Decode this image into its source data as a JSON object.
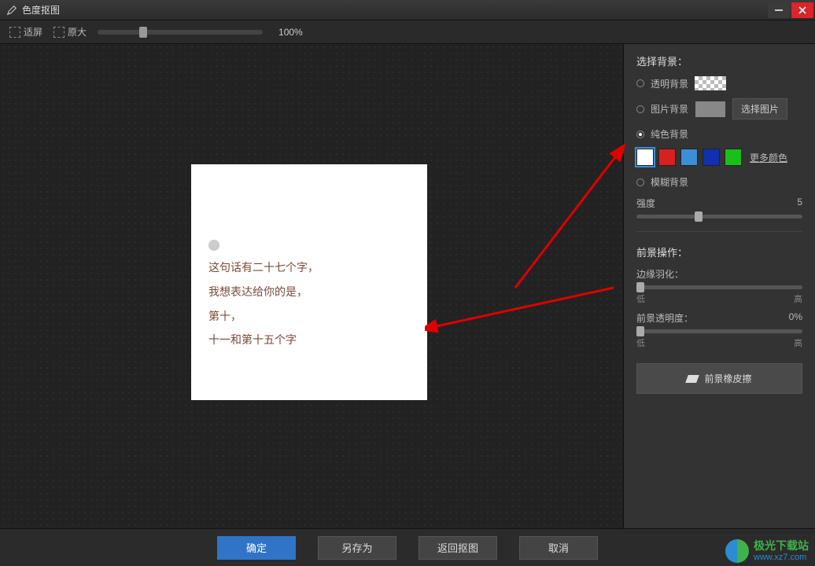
{
  "window": {
    "title": "色度抠图"
  },
  "toolbar": {
    "fit_label": "适屏",
    "orig_label": "原大",
    "zoom_percent": "100%"
  },
  "canvas": {
    "lines": [
      "这句话有二十七个字，",
      "我想表达给你的是，",
      "第十，",
      "十一和第十五个字"
    ]
  },
  "sidebar": {
    "bg_section": "选择背景：",
    "transparent": "透明背景",
    "image_bg": "图片背景",
    "choose_image_btn": "选择图片",
    "solid_bg": "纯色背景",
    "more_colors": "更多颜色",
    "blur_bg": "模糊背景",
    "intensity_label": "强度",
    "intensity_value": "5",
    "fg_section": "前景操作：",
    "feather_label": "边缘羽化：",
    "low": "低",
    "high": "高",
    "opacity_label": "前景透明度：",
    "opacity_value": "0%",
    "eraser_btn": "前景橡皮擦"
  },
  "colors": {
    "swatches": [
      "#ffffff",
      "#d92020",
      "#3a8fd8",
      "#1030b0",
      "#18c018"
    ]
  },
  "footer": {
    "ok": "确定",
    "save_as": "另存为",
    "back": "返回抠图",
    "cancel": "取消"
  },
  "watermark": {
    "name": "极光下载站",
    "url": "www.xz7.com"
  }
}
